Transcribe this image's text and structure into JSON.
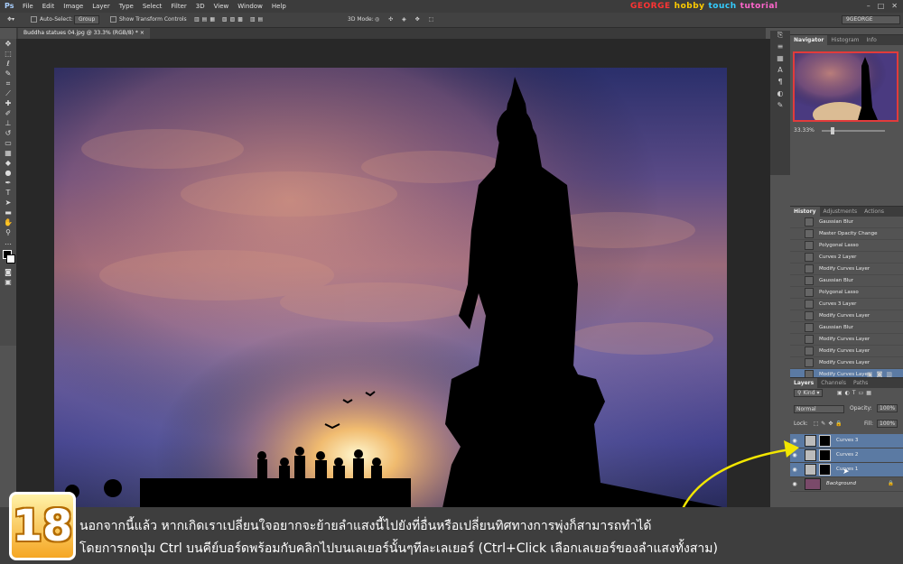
{
  "app_logo": "Ps",
  "menu": [
    "File",
    "Edit",
    "Image",
    "Layer",
    "Type",
    "Select",
    "Filter",
    "3D",
    "View",
    "Window",
    "Help"
  ],
  "brand": {
    "part1": "GEORGE",
    "part2": "hobby",
    "part3": "touch",
    "part4": "tutorial"
  },
  "options_bar": {
    "auto_select_label": "Auto-Select:",
    "auto_select_value": "Group",
    "show_transform_label": "Show Transform Controls",
    "mode_3d_label": "3D Mode:",
    "workspace": "9GEORGE"
  },
  "document_tab": "Buddha statues 04.jpg @ 33.3% (RGB/8) *",
  "navigator": {
    "tabs": [
      "Navigator",
      "Histogram",
      "Info"
    ],
    "zoom": "33.33%"
  },
  "history": {
    "tabs": [
      "History",
      "Adjustments",
      "Actions"
    ],
    "items": [
      "Gaussian Blur",
      "Master Opacity Change",
      "Polygonal Lasso",
      "Curves 2 Layer",
      "Modify Curves Layer",
      "Gaussian Blur",
      "Polygonal Lasso",
      "Curves 3 Layer",
      "Modify Curves Layer",
      "Gaussian Blur",
      "Modify Curves Layer",
      "Modify Curves Layer",
      "Modify Curves Layer",
      "Modify Curves Layer"
    ]
  },
  "layers": {
    "tabs": [
      "Layers",
      "Channels",
      "Paths"
    ],
    "kind_label": "Kind",
    "blend_mode": "Normal",
    "opacity_label": "Opacity:",
    "opacity_value": "100%",
    "lock_label": "Lock:",
    "fill_label": "Fill:",
    "fill_value": "100%",
    "items": [
      {
        "name": "Curves 3"
      },
      {
        "name": "Curves 2"
      },
      {
        "name": "Curves 1"
      },
      {
        "name": "Background"
      }
    ]
  },
  "caption": {
    "step": "18",
    "line1": "นอกจากนี้แล้ว หากเกิดเราเปลี่ยนใจอยากจะย้ายลำแสงนี้ไปยังที่อื่นหรือเปลี่ยนทิศทางการพุ่งก็สามารถทำได้",
    "line2": "โดยการกดปุ่ม Ctrl บนคีย์บอร์ดพร้อมกับคลิกไปบนเลเยอร์นั้นๆทีละเลเยอร์ (Ctrl+Click เลือกเลเยอร์ของลำแสงทั้งสาม)"
  },
  "colors": {
    "accent_selection": "#5b7aa3",
    "arrow": "#f2e600",
    "nav_frame": "#e23b3b"
  }
}
